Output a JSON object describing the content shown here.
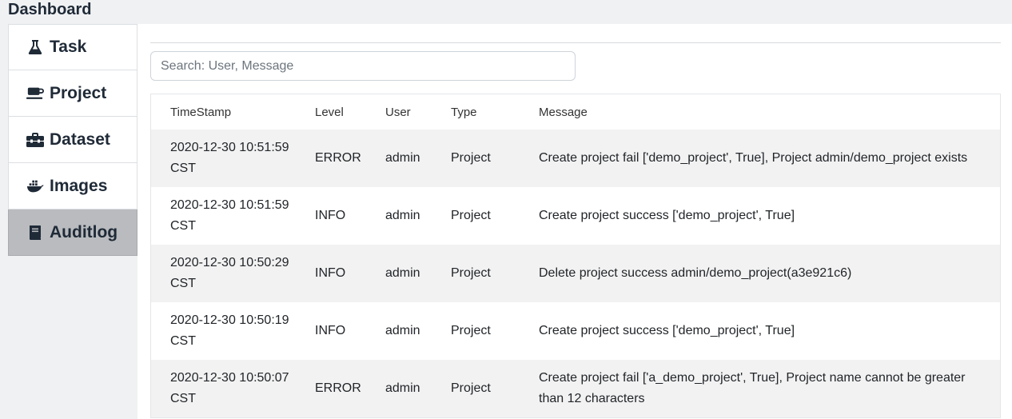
{
  "header": {
    "title": "Dashboard"
  },
  "sidebar": {
    "items": [
      {
        "label": "Task",
        "icon": "flask-icon",
        "active": false
      },
      {
        "label": "Project",
        "icon": "coffee-cup-icon",
        "active": false
      },
      {
        "label": "Dataset",
        "icon": "toolbox-icon",
        "active": false
      },
      {
        "label": "Images",
        "icon": "docker-whale-icon",
        "active": false
      },
      {
        "label": "Auditlog",
        "icon": "book-icon",
        "active": true
      }
    ]
  },
  "search": {
    "placeholder": "Search: User, Message",
    "value": ""
  },
  "table": {
    "columns": [
      "TimeStamp",
      "Level",
      "User",
      "Type",
      "Message"
    ],
    "rows": [
      {
        "timestamp": "2020-12-30 10:51:59 CST",
        "level": "ERROR",
        "user": "admin",
        "type": "Project",
        "message": "Create project fail ['demo_project', True], Project admin/demo_project exists"
      },
      {
        "timestamp": "2020-12-30 10:51:59 CST",
        "level": "INFO",
        "user": "admin",
        "type": "Project",
        "message": "Create project success ['demo_project', True]"
      },
      {
        "timestamp": "2020-12-30 10:50:29 CST",
        "level": "INFO",
        "user": "admin",
        "type": "Project",
        "message": "Delete project success admin/demo_project(a3e921c6)"
      },
      {
        "timestamp": "2020-12-30 10:50:19 CST",
        "level": "INFO",
        "user": "admin",
        "type": "Project",
        "message": "Create project success ['demo_project', True]"
      },
      {
        "timestamp": "2020-12-30 10:50:07 CST",
        "level": "ERROR",
        "user": "admin",
        "type": "Project",
        "message": "Create project fail ['a_demo_project', True], Project name cannot be greater than 12 characters"
      }
    ]
  }
}
